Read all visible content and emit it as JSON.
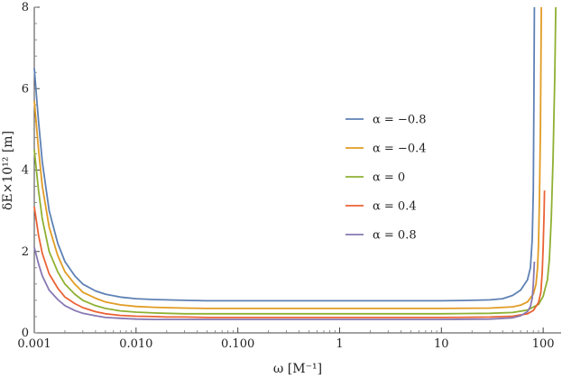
{
  "chart_data": {
    "type": "line",
    "title": "",
    "xlabel": "ω [M⁻¹]",
    "ylabel": "δE×10¹² [m]",
    "x_scale": "log",
    "xlim": [
      0.001,
      150
    ],
    "ylim": [
      0,
      8
    ],
    "grid": false,
    "legend_position": "center-right",
    "x_ticks": [
      {
        "value": 0.001,
        "label": "0.001"
      },
      {
        "value": 0.01,
        "label": "0.010"
      },
      {
        "value": 0.1,
        "label": "0.100"
      },
      {
        "value": 1,
        "label": "1"
      },
      {
        "value": 10,
        "label": "10"
      },
      {
        "value": 100,
        "label": "100"
      }
    ],
    "y_ticks": [
      {
        "value": 0,
        "label": "0"
      },
      {
        "value": 2,
        "label": "2"
      },
      {
        "value": 4,
        "label": "4"
      },
      {
        "value": 6,
        "label": "6"
      },
      {
        "value": 8,
        "label": "8"
      }
    ],
    "series": [
      {
        "name": "α = −0.8",
        "color": "#5E81B5",
        "x": [
          0.001,
          0.0011,
          0.0012,
          0.0014,
          0.0017,
          0.002,
          0.0025,
          0.003,
          0.004,
          0.005,
          0.007,
          0.01,
          0.015,
          0.02,
          0.03,
          0.05,
          0.1,
          1,
          10,
          20,
          30,
          40,
          50,
          60,
          70,
          75,
          78,
          80,
          81,
          82
        ],
        "y": [
          6.5,
          5.2,
          4.2,
          3.0,
          2.2,
          1.75,
          1.4,
          1.2,
          1.03,
          0.95,
          0.88,
          0.84,
          0.82,
          0.81,
          0.8,
          0.79,
          0.79,
          0.79,
          0.79,
          0.8,
          0.81,
          0.84,
          0.92,
          1.05,
          1.3,
          1.6,
          2.3,
          3.5,
          5.5,
          8.0
        ]
      },
      {
        "name": "α = −0.4",
        "color": "#E19C24",
        "x": [
          0.001,
          0.0011,
          0.0012,
          0.0014,
          0.0017,
          0.002,
          0.0025,
          0.003,
          0.004,
          0.005,
          0.007,
          0.01,
          0.015,
          0.02,
          0.03,
          0.05,
          0.1,
          1,
          10,
          30,
          50,
          60,
          70,
          80,
          85,
          88,
          90,
          92,
          94,
          96
        ],
        "y": [
          5.7,
          4.5,
          3.6,
          2.6,
          1.9,
          1.5,
          1.2,
          1.0,
          0.85,
          0.76,
          0.69,
          0.65,
          0.63,
          0.62,
          0.61,
          0.6,
          0.6,
          0.6,
          0.6,
          0.61,
          0.64,
          0.68,
          0.76,
          0.95,
          1.2,
          1.6,
          2.2,
          3.3,
          5.0,
          8.0
        ]
      },
      {
        "name": "α = 0",
        "color": "#8FB032",
        "x": [
          0.001,
          0.0011,
          0.0012,
          0.0014,
          0.0017,
          0.002,
          0.0025,
          0.003,
          0.004,
          0.005,
          0.007,
          0.01,
          0.015,
          0.02,
          0.03,
          0.05,
          0.1,
          1,
          10,
          30,
          50,
          70,
          90,
          100,
          110,
          115,
          120,
          125,
          130,
          133
        ],
        "y": [
          4.5,
          3.5,
          2.8,
          2.0,
          1.5,
          1.2,
          0.95,
          0.8,
          0.67,
          0.6,
          0.54,
          0.51,
          0.49,
          0.48,
          0.47,
          0.47,
          0.47,
          0.47,
          0.47,
          0.48,
          0.5,
          0.56,
          0.7,
          0.9,
          1.3,
          1.8,
          2.8,
          4.3,
          6.3,
          8.0
        ]
      },
      {
        "name": "α = 0.4",
        "color": "#EB6235",
        "x": [
          0.001,
          0.0011,
          0.0012,
          0.0014,
          0.0017,
          0.002,
          0.0025,
          0.003,
          0.004,
          0.005,
          0.007,
          0.01,
          0.015,
          0.02,
          0.03,
          0.05,
          0.1,
          1,
          10,
          30,
          50,
          70,
          80,
          90,
          95,
          98,
          100,
          102,
          103
        ],
        "y": [
          3.1,
          2.4,
          1.95,
          1.45,
          1.1,
          0.88,
          0.72,
          0.62,
          0.52,
          0.47,
          0.43,
          0.41,
          0.4,
          0.39,
          0.39,
          0.38,
          0.38,
          0.38,
          0.38,
          0.39,
          0.41,
          0.47,
          0.55,
          0.75,
          1.0,
          1.5,
          2.1,
          2.9,
          3.5
        ]
      },
      {
        "name": "α = 0.8",
        "color": "#8778B3",
        "x": [
          0.001,
          0.0011,
          0.0012,
          0.0014,
          0.0017,
          0.002,
          0.0025,
          0.003,
          0.004,
          0.005,
          0.007,
          0.01,
          0.015,
          0.02,
          0.03,
          0.05,
          0.1,
          1,
          10,
          30,
          50,
          60,
          70,
          75,
          78,
          80,
          82
        ],
        "y": [
          2.1,
          1.7,
          1.4,
          1.05,
          0.82,
          0.67,
          0.55,
          0.48,
          0.42,
          0.38,
          0.36,
          0.34,
          0.33,
          0.33,
          0.33,
          0.33,
          0.33,
          0.33,
          0.33,
          0.34,
          0.37,
          0.42,
          0.52,
          0.65,
          0.85,
          1.2,
          1.75
        ]
      }
    ]
  }
}
